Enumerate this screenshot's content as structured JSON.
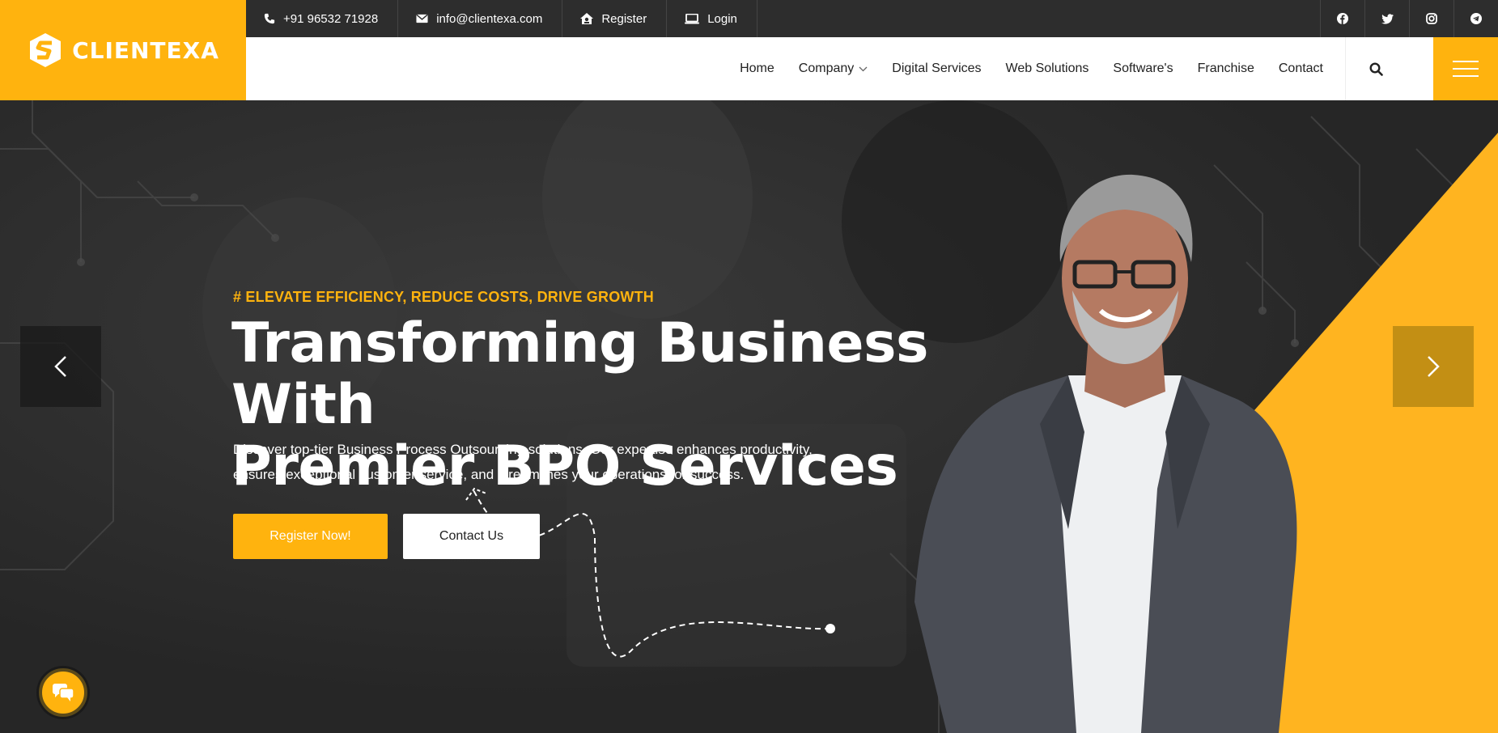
{
  "brand": {
    "name": "CLIENTEXA",
    "accent": "#ffb30e",
    "dark": "#2d2d2d"
  },
  "topbar": {
    "phone": "+91 96532 71928",
    "email": "info@clientexa.com",
    "register": "Register",
    "login": "Login",
    "social": [
      "facebook-icon",
      "twitter-icon",
      "instagram-icon",
      "telegram-icon"
    ]
  },
  "nav": {
    "items": [
      "Home",
      "Company",
      "Digital Services",
      "Web Solutions",
      "Software's",
      "Franchise",
      "Contact"
    ]
  },
  "hero": {
    "tagline": "# ELEVATE EFFICIENCY, REDUCE COSTS, DRIVE GROWTH",
    "title_line1": "Transforming Business With",
    "title_line2": "Premier BPO Services",
    "description_line1": "Discover top-tier Business Process Outsourcing solutions. Our expertise enhances productivity,",
    "description_line2": "ensures exceptional customer service, and streamlines your operations for success.",
    "primary_button": "Register Now!",
    "secondary_button": "Contact Us"
  }
}
